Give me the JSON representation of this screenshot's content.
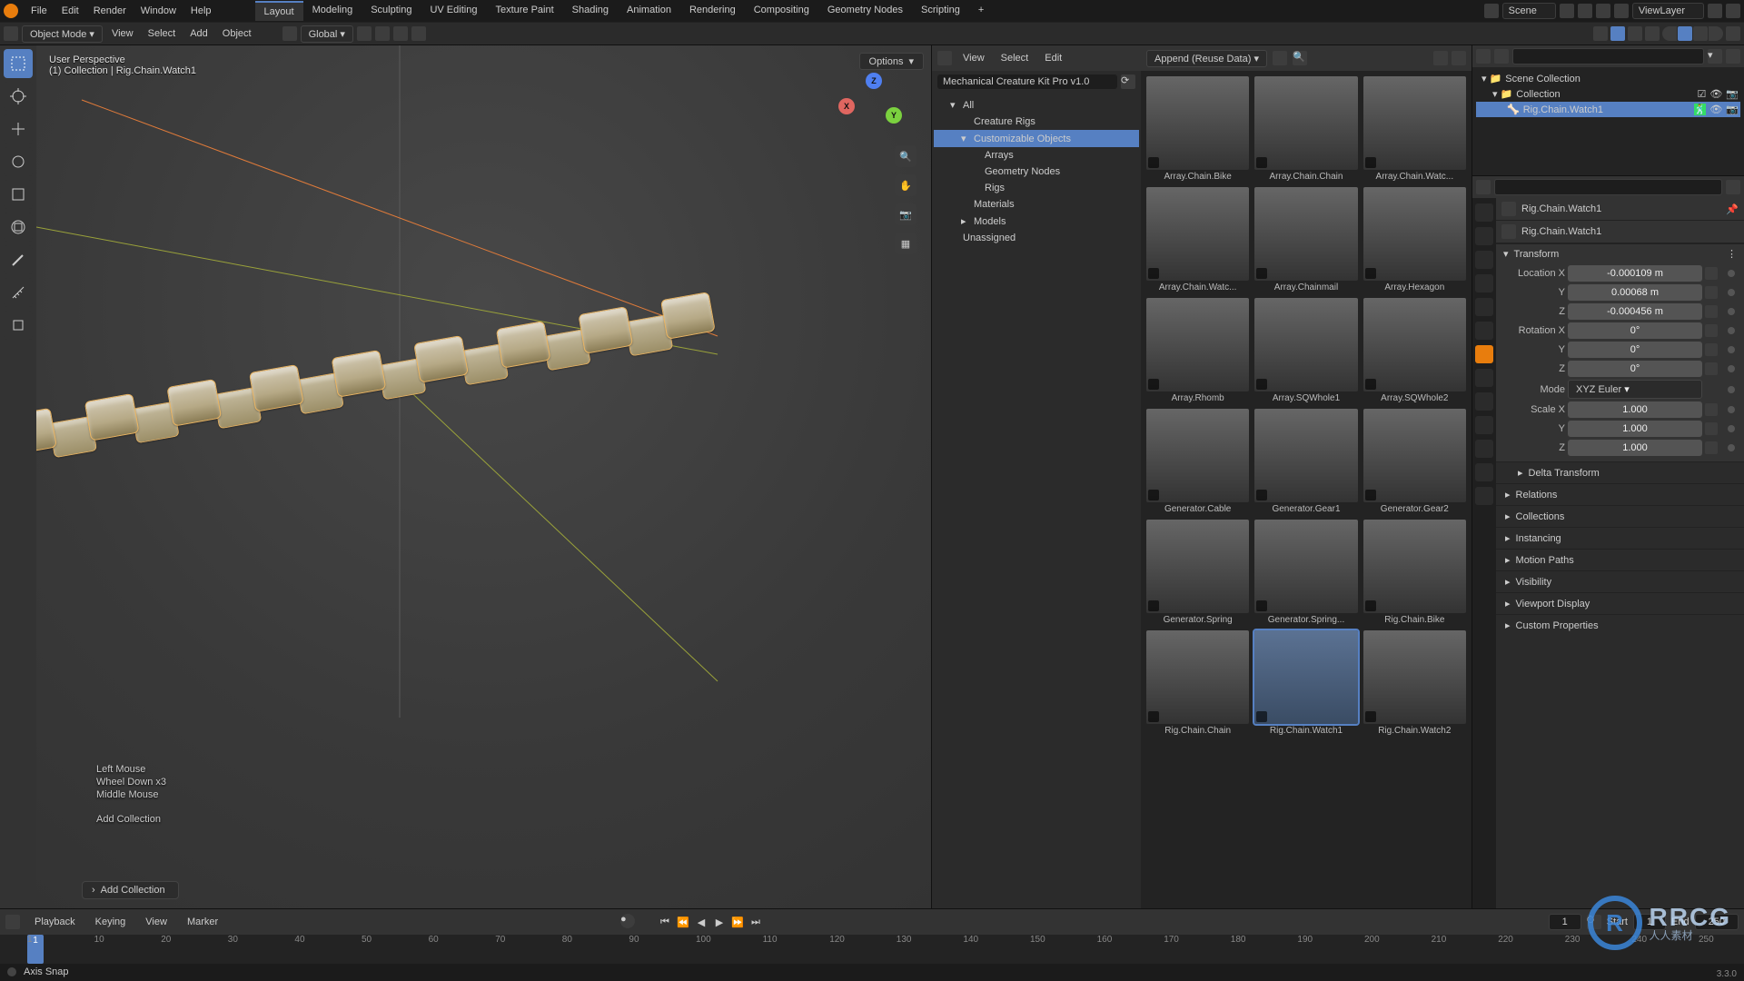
{
  "top_menu": [
    "File",
    "Edit",
    "Render",
    "Window",
    "Help"
  ],
  "workspaces": [
    "Layout",
    "Modeling",
    "Sculpting",
    "UV Editing",
    "Texture Paint",
    "Shading",
    "Animation",
    "Rendering",
    "Compositing",
    "Geometry Nodes",
    "Scripting"
  ],
  "active_workspace": "Layout",
  "scene_name": "Scene",
  "viewlayer_name": "ViewLayer",
  "mode": "Object Mode",
  "hdr_menus": [
    "View",
    "Select",
    "Add",
    "Object"
  ],
  "orientation": "Global",
  "options_label": "Options",
  "asset_hdr_menus": [
    "View",
    "Select",
    "Edit"
  ],
  "asset_import": "Append (Reuse Data)",
  "asset_library": "Mechanical Creature Kit Pro v1.0",
  "asset_tree": [
    {
      "label": "All",
      "level": 1
    },
    {
      "label": "Creature Rigs",
      "level": 2
    },
    {
      "label": "Customizable Objects",
      "level": 2,
      "selected": true,
      "expanded": true
    },
    {
      "label": "Arrays",
      "level": 3
    },
    {
      "label": "Geometry Nodes",
      "level": 3
    },
    {
      "label": "Rigs",
      "level": 3
    },
    {
      "label": "Materials",
      "level": 2
    },
    {
      "label": "Models",
      "level": 2,
      "collapsed": true
    },
    {
      "label": "Unassigned",
      "level": 1
    }
  ],
  "assets": [
    {
      "label": "Array.Chain.Bike"
    },
    {
      "label": "Array.Chain.Chain"
    },
    {
      "label": "Array.Chain.Watc..."
    },
    {
      "label": "Array.Chain.Watc..."
    },
    {
      "label": "Array.Chainmail"
    },
    {
      "label": "Array.Hexagon"
    },
    {
      "label": "Array.Rhomb"
    },
    {
      "label": "Array.SQWhole1"
    },
    {
      "label": "Array.SQWhole2"
    },
    {
      "label": "Generator.Cable"
    },
    {
      "label": "Generator.Gear1"
    },
    {
      "label": "Generator.Gear2"
    },
    {
      "label": "Generator.Spring"
    },
    {
      "label": "Generator.Spring..."
    },
    {
      "label": "Rig.Chain.Bike"
    },
    {
      "label": "Rig.Chain.Chain"
    },
    {
      "label": "Rig.Chain.Watch1",
      "selected": true
    },
    {
      "label": "Rig.Chain.Watch2"
    }
  ],
  "outliner": {
    "root": "Scene Collection",
    "collection": "Collection",
    "item": "Rig.Chain.Watch1"
  },
  "props": {
    "breadcrumb1": "Rig.Chain.Watch1",
    "breadcrumb2": "Rig.Chain.Watch1",
    "transform_label": "Transform",
    "loc_label": "Location X",
    "loc": {
      "x": "-0.000109 m",
      "y": "0.00068 m",
      "z": "-0.000456 m"
    },
    "rot_label": "Rotation X",
    "rot": {
      "x": "0°",
      "y": "0°",
      "z": "0°"
    },
    "mode_label": "Mode",
    "mode_value": "XYZ Euler",
    "scale_label": "Scale X",
    "scale": {
      "x": "1.000",
      "y": "1.000",
      "z": "1.000"
    },
    "sections": [
      "Delta Transform",
      "Relations",
      "Collections",
      "Instancing",
      "Motion Paths",
      "Visibility",
      "Viewport Display",
      "Custom Properties"
    ]
  },
  "hud": {
    "l1": "User Perspective",
    "l2": "(1) Collection | Rig.Chain.Watch1"
  },
  "overlay": [
    "Left Mouse",
    "Wheel Down x3",
    "Middle Mouse",
    "",
    "Add Collection"
  ],
  "add_collection_btn": "Add Collection",
  "tl": {
    "menus": [
      "Playback",
      "Keying",
      "View",
      "Marker"
    ],
    "current": "1",
    "start_label": "Start",
    "start": "1",
    "end_label": "End",
    "end": "250",
    "ticks": [
      "1",
      "10",
      "20",
      "30",
      "40",
      "50",
      "60",
      "70",
      "80",
      "90",
      "100",
      "110",
      "120",
      "130",
      "140",
      "150",
      "160",
      "170",
      "180",
      "190",
      "200",
      "210",
      "220",
      "230",
      "240",
      "250"
    ]
  },
  "status": "Axis Snap",
  "version": "3.3.0",
  "watermark": {
    "big": "RRCG",
    "small": "人人素材"
  }
}
